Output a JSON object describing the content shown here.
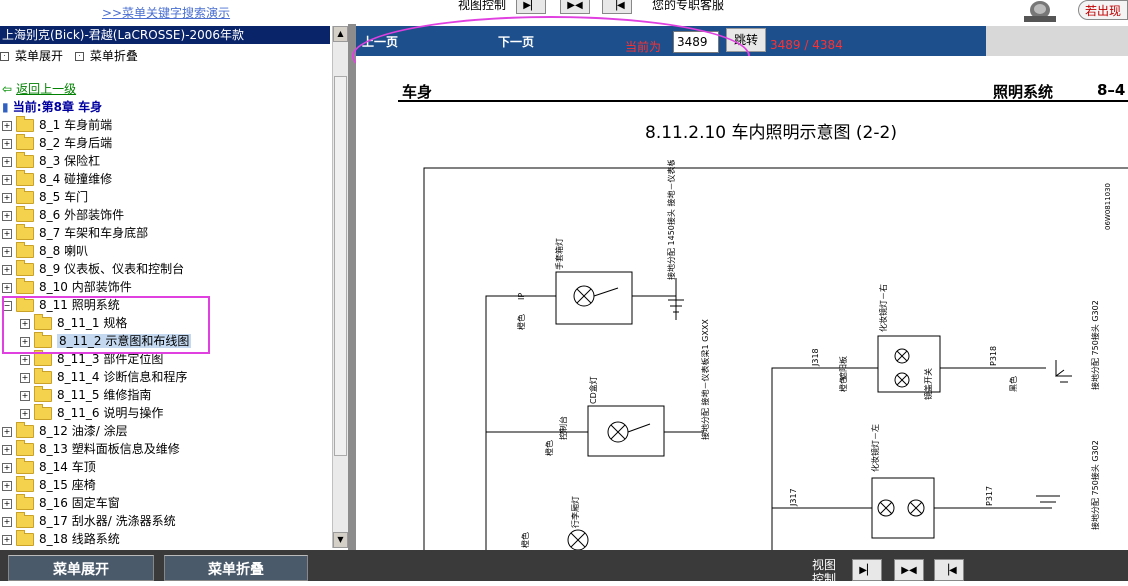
{
  "top": {
    "search_demo_link": ">>菜单关键字搜索演示",
    "view_control_label": "视图控制",
    "service_text": "您的专职客服",
    "exit_label": "若出现"
  },
  "tree": {
    "title": "上海别克(Bick)-君越(LaCROSSE)-2006年款",
    "expand_label": "菜单展开",
    "collapse_label": "菜单折叠",
    "back_label": "返回上一级",
    "current_label": "当前:第8章  车身",
    "items": [
      {
        "code": "8_1",
        "label": "车身前端"
      },
      {
        "code": "8_2",
        "label": "车身后端"
      },
      {
        "code": "8_3",
        "label": "保险杠"
      },
      {
        "code": "8_4",
        "label": "碰撞维修"
      },
      {
        "code": "8_5",
        "label": "车门"
      },
      {
        "code": "8_6",
        "label": "外部装饰件"
      },
      {
        "code": "8_7",
        "label": "车架和车身底部"
      },
      {
        "code": "8_8",
        "label": "喇叭"
      },
      {
        "code": "8_9",
        "label": "仪表板、仪表和控制台"
      },
      {
        "code": "8_10",
        "label": "内部装饰件"
      },
      {
        "code": "8_11",
        "label": "照明系统"
      },
      {
        "code": "8_11_1",
        "label": "规格"
      },
      {
        "code": "8_11_2",
        "label": "示意图和布线图"
      },
      {
        "code": "8_11_3",
        "label": "部件定位图"
      },
      {
        "code": "8_11_4",
        "label": "诊断信息和程序"
      },
      {
        "code": "8_11_5",
        "label": "维修指南"
      },
      {
        "code": "8_11_6",
        "label": "说明与操作"
      },
      {
        "code": "8_12",
        "label": "油漆/ 涂层"
      },
      {
        "code": "8_13",
        "label": "塑料面板信息及维修"
      },
      {
        "code": "8_14",
        "label": "车顶"
      },
      {
        "code": "8_15",
        "label": "座椅"
      },
      {
        "code": "8_16",
        "label": "固定车窗"
      },
      {
        "code": "8_17",
        "label": "刮水器/ 洗涤器系统"
      },
      {
        "code": "8_18",
        "label": "线路系统"
      }
    ]
  },
  "doc_toolbar": {
    "prev_label": "上一页",
    "next_label": "下一页",
    "current_label": "当前为",
    "page_input_value": "3489",
    "go_label": "跳转",
    "page_count": "3489 / 4384"
  },
  "doc": {
    "header_left": "车身",
    "header_right": "照明系统",
    "page_number": "8–4",
    "title": "8.11.2.10 车内照明示意图 (2-2)",
    "diagram_code": "06W0811030",
    "labels": {
      "glovebox_lamp": "手套箱灯",
      "cd_lamp": "CD盒灯",
      "trunk_lamp": "行李厢灯",
      "vanity_right": "化妆镜灯－右",
      "vanity_left": "化妆镜灯－左",
      "ground1": "接地分配 1450接头 接地－仪表板梁2 GXXX",
      "ground2": "接地分配 接地－仪表板梁1 GXXX",
      "ground3": "接地分配 750接头 G302",
      "ground4": "接地分配 750接头 G302",
      "wire_orange": "橙色",
      "wire_black": "黑色",
      "ip": "IP",
      "j318": "J318",
      "p318": "P318",
      "j317": "J317",
      "p317": "P317",
      "mirror_switch": "镜盖开关",
      "dimmer": "控制台",
      "light_controller": "遮阳板"
    }
  },
  "bottom": {
    "expand_button": "菜单展开",
    "collapse_button": "菜单折叠",
    "view_control_label": "视图控制"
  }
}
